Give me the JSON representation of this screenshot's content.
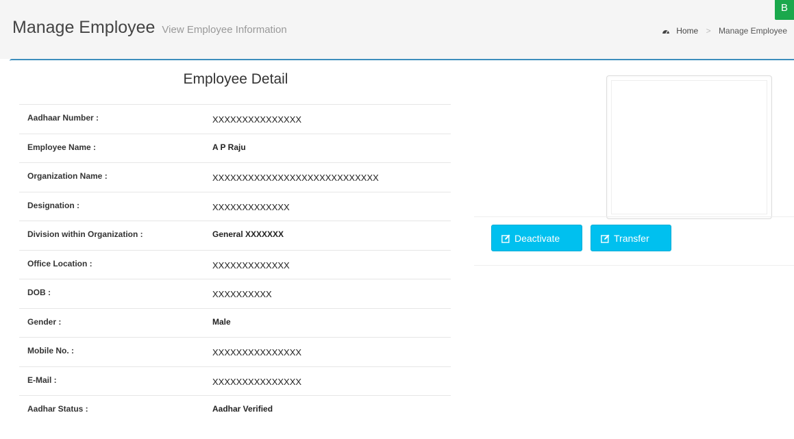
{
  "header": {
    "title": "Manage Employee",
    "subtitle": "View Employee Information",
    "corner_button_label": "B"
  },
  "breadcrumb": {
    "home_label": "Home",
    "current_label": "Manage Employee",
    "home_icon": "dashboard-icon"
  },
  "detail": {
    "title": "Employee Detail",
    "rows": [
      {
        "label": "Aadhaar Number :",
        "value": "XXXXXXXXXXXXXXX"
      },
      {
        "label": "Employee Name :",
        "value": "A P Raju"
      },
      {
        "label": "Organization Name :",
        "value": "XXXXXXXXXXXXXXXXXXXXXXXXXXXX"
      },
      {
        "label": "Designation :",
        "value": "XXXXXXXXXXXXX"
      },
      {
        "label": "Division within Organization :",
        "value": "General XXXXXXX"
      },
      {
        "label": "Office Location :",
        "value": "XXXXXXXXXXXXX"
      },
      {
        "label": "DOB :",
        "value": "XXXXXXXXXX"
      },
      {
        "label": "Gender :",
        "value": "Male"
      },
      {
        "label": "Mobile No. :",
        "value": "XXXXXXXXXXXXXXX"
      },
      {
        "label": "E-Mail :",
        "value": "XXXXXXXXXXXXXXX"
      },
      {
        "label": "Aadhar Status :",
        "value": "Aadhar Verified"
      }
    ]
  },
  "actions": {
    "deactivate_label": "Deactivate",
    "transfer_label": "Transfer",
    "icon": "edit-icon"
  },
  "colors": {
    "accent": "#3c8dbc",
    "button_info": "#00c0ef",
    "corner_button": "#1aa84c"
  }
}
